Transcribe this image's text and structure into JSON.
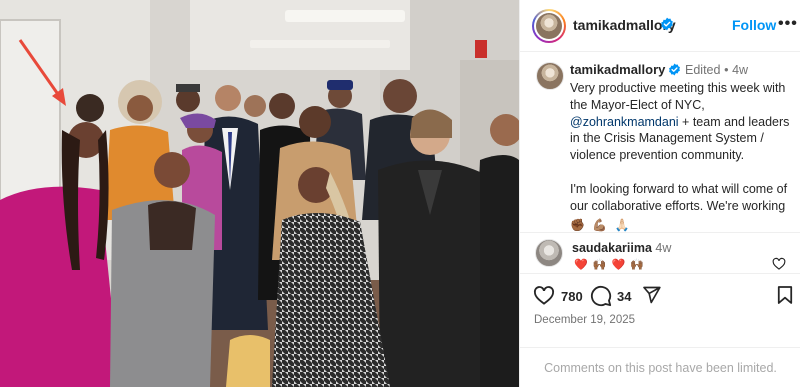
{
  "post": {
    "username": "tamikadmallory",
    "follow_label": "Follow",
    "more_label": "•••"
  },
  "caption": {
    "username": "tamikadmallory",
    "edited": "Edited",
    "separator": "•",
    "time": "4w",
    "line1_before_mention": "Very productive meeting this week with the Mayor-Elect of NYC, ",
    "mention": "@zohrankmamdani",
    "line1_after_mention": " + team and leaders in the Crisis Management System / violence prevention community.",
    "line2": "I'm looking forward to what will come of our collaborative efforts. We're working",
    "emojis": "✊🏾 💪🏽 🙏🏻"
  },
  "comment": {
    "username": "saudakariima",
    "time": "4w",
    "text": "❤️ 🙌🏾 ❤️ 🙌🏾"
  },
  "stats": {
    "likes": "780",
    "comments": "34",
    "date": "December 19, 2025"
  },
  "footer": {
    "limited_text": "Comments on this post have been limited."
  },
  "colors": {
    "accent": "#0095f6",
    "verified": "#0095f6",
    "arrow": "#e8493a",
    "mention": "#00376b"
  }
}
